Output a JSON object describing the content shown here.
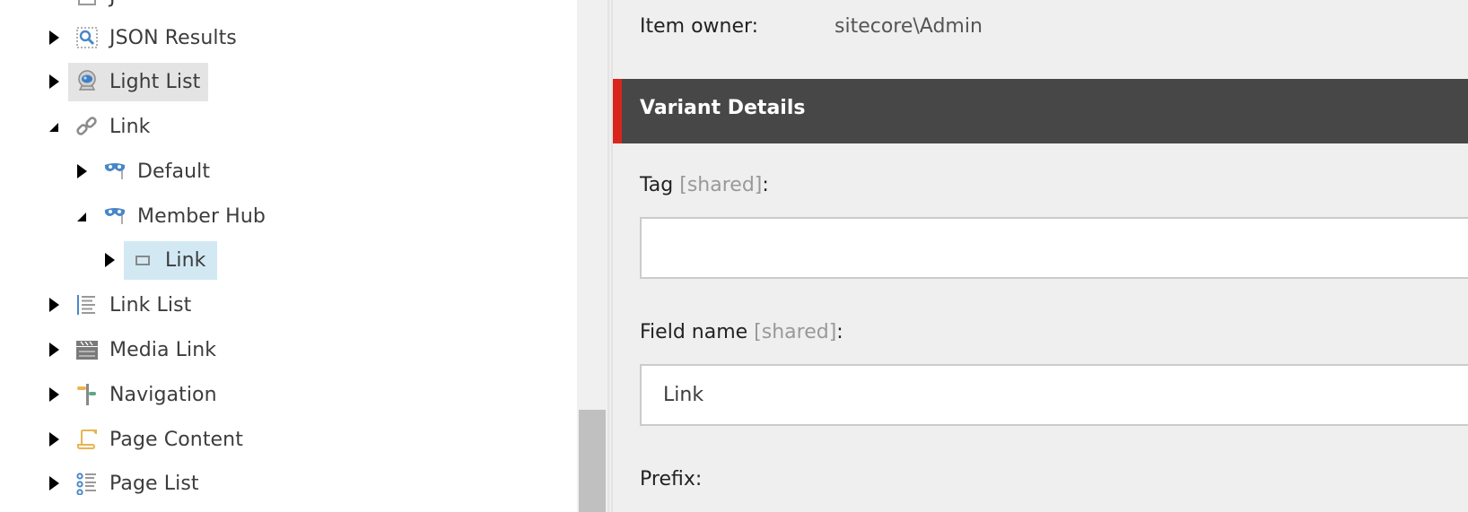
{
  "tree": {
    "partial_top_item": {
      "label": "J"
    },
    "items": [
      {
        "label": "JSON Results",
        "icon": "json-results-icon",
        "expanded": false,
        "level": 0,
        "state": "normal"
      },
      {
        "label": "Light List",
        "icon": "webcam-icon",
        "expanded": false,
        "level": 0,
        "state": "hover"
      },
      {
        "label": "Link",
        "icon": "chain-link-icon",
        "expanded": true,
        "level": 0,
        "state": "normal"
      },
      {
        "label": "Default",
        "icon": "mask-icon",
        "expanded": false,
        "level": 1,
        "state": "normal"
      },
      {
        "label": "Member Hub",
        "icon": "mask-icon",
        "expanded": true,
        "level": 1,
        "state": "normal"
      },
      {
        "label": "Link",
        "icon": "rectangle-icon",
        "expanded": false,
        "level": 2,
        "state": "selected"
      },
      {
        "label": "Link List",
        "icon": "list-lines-icon",
        "expanded": false,
        "level": 0,
        "state": "normal"
      },
      {
        "label": "Media Link",
        "icon": "clapperboard-icon",
        "expanded": false,
        "level": 0,
        "state": "normal"
      },
      {
        "label": "Navigation",
        "icon": "signpost-icon",
        "expanded": false,
        "level": 0,
        "state": "normal"
      },
      {
        "label": "Page Content",
        "icon": "scroll-icon",
        "expanded": false,
        "level": 0,
        "state": "normal"
      },
      {
        "label": "Page List",
        "icon": "bullet-list-icon",
        "expanded": false,
        "level": 0,
        "state": "normal"
      }
    ]
  },
  "content": {
    "item_owner": {
      "label": "Item owner:",
      "value": "sitecore\\Admin"
    },
    "section": {
      "title": "Variant Details",
      "accent_color": "#d8261d"
    },
    "fields": [
      {
        "label": "Tag",
        "shared": "[shared]",
        "suffix": ":",
        "value": ""
      },
      {
        "label": "Field name",
        "shared": "[shared]",
        "suffix": ":",
        "value": "Link"
      },
      {
        "label": "Prefix:"
      }
    ]
  }
}
